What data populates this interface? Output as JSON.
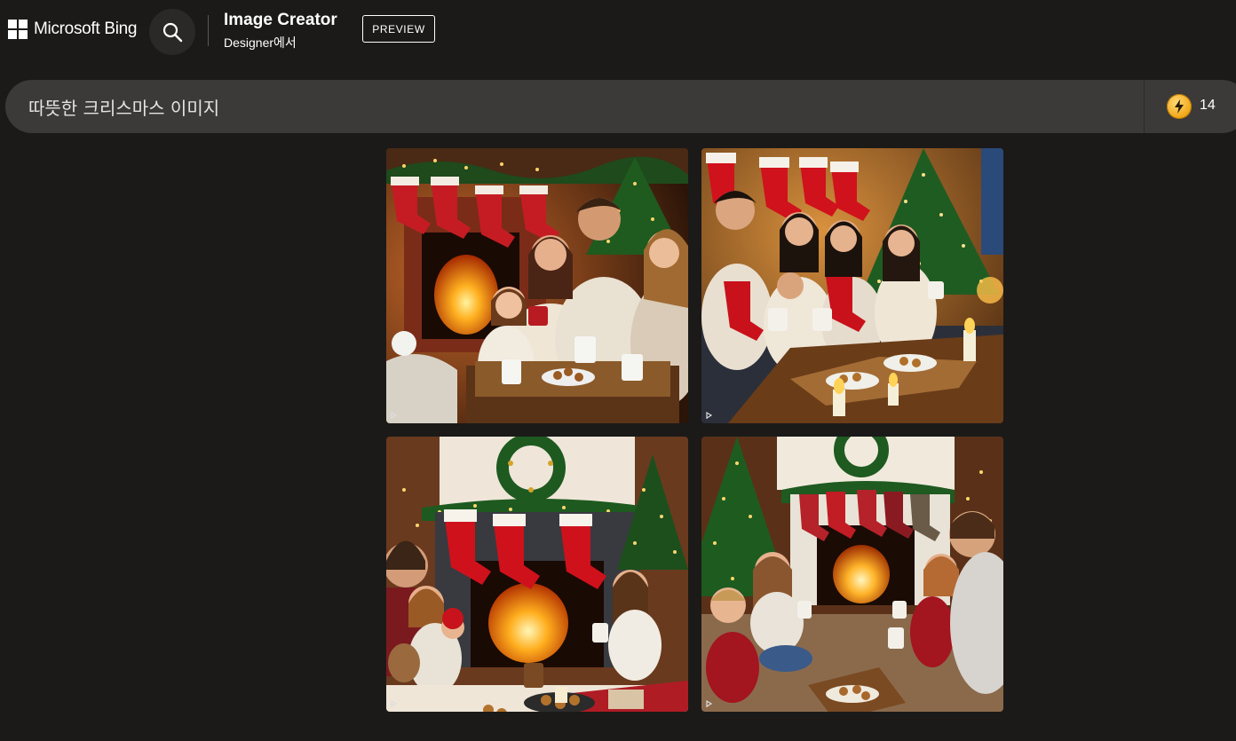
{
  "header": {
    "brand": "Microsoft Bing",
    "app_title": "Image Creator",
    "app_subtitle": "Designer에서",
    "preview_label": "PREVIEW"
  },
  "prompt": {
    "value": "따뜻한 크리스마스 이미지"
  },
  "boosts": {
    "count": "14"
  },
  "results": [
    {
      "name": "family by fireplace with stockings and cocoa"
    },
    {
      "name": "family on couch with stockings and candles"
    },
    {
      "name": "family by fireplace with wreath and cookies"
    },
    {
      "name": "family sitting on floor by fireplace"
    }
  ],
  "colors": {
    "background": "#1b1a19",
    "prompt_bar": "#3b3a39",
    "boost_coin": "#f2a91a"
  }
}
